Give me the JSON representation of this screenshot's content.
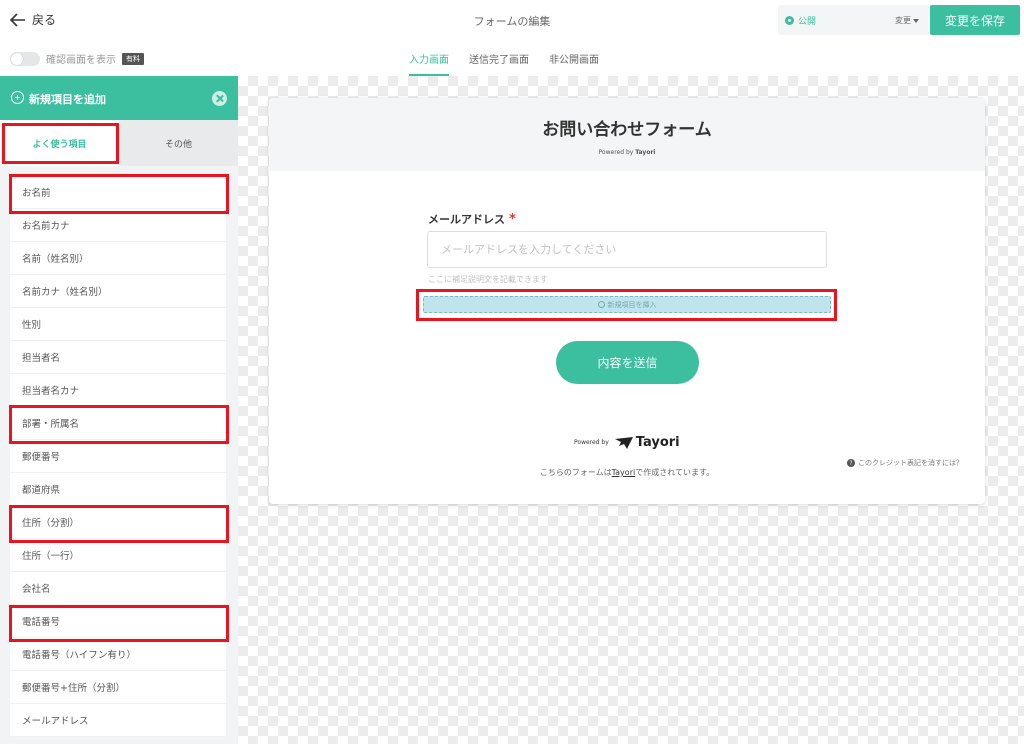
{
  "header": {
    "back_label": "戻る",
    "title": "フォームの編集",
    "status_label": "公開",
    "status_change_label": "変更",
    "save_label": "変更を保存",
    "accent_color": "#3bbf9e"
  },
  "subbar": {
    "toggle_label": "確認画面を表示",
    "paid_badge": "有料",
    "tabs": [
      {
        "label": "入力画面",
        "active": true
      },
      {
        "label": "送信完了画面",
        "active": false
      },
      {
        "label": "非公開画面",
        "active": false
      }
    ]
  },
  "sidebar": {
    "title": "新規項目を追加",
    "tabs": [
      {
        "label": "よく使う項目",
        "active": true
      },
      {
        "label": "その他",
        "active": false
      }
    ],
    "items": [
      {
        "label": "お名前"
      },
      {
        "label": "お名前カナ"
      },
      {
        "label": "名前（姓名別）"
      },
      {
        "label": "名前カナ（姓名別）"
      },
      {
        "label": "性別"
      },
      {
        "label": "担当者名"
      },
      {
        "label": "担当者名カナ"
      },
      {
        "label": "部署・所属名"
      },
      {
        "label": "郵便番号"
      },
      {
        "label": "都道府県"
      },
      {
        "label": "住所（分割）"
      },
      {
        "label": "住所（一行）"
      },
      {
        "label": "会社名"
      },
      {
        "label": "電話番号"
      },
      {
        "label": "電話番号（ハイフン有り）"
      },
      {
        "label": "郵便番号+住所（分割）"
      },
      {
        "label": "メールアドレス"
      }
    ]
  },
  "form": {
    "title": "お問い合わせフォーム",
    "powered_prefix": "Powered by",
    "powered_brand": "Tayori",
    "field_label": "メールアドレス",
    "required_mark": "*",
    "email_placeholder": "メールアドレスを入力してください",
    "hint": "ここに補足説明文を記載できます",
    "insert_label": "新規項目を挿入",
    "submit_label": "内容を送信",
    "footer_powered": "Powered by",
    "footer_brand": "Tayori",
    "credit_before": "こちらのフォームは",
    "credit_link": "Tayori",
    "credit_after": "で作成されています。",
    "remove_credit": "このクレジット表記を消すには？",
    "q_icon": "?"
  }
}
